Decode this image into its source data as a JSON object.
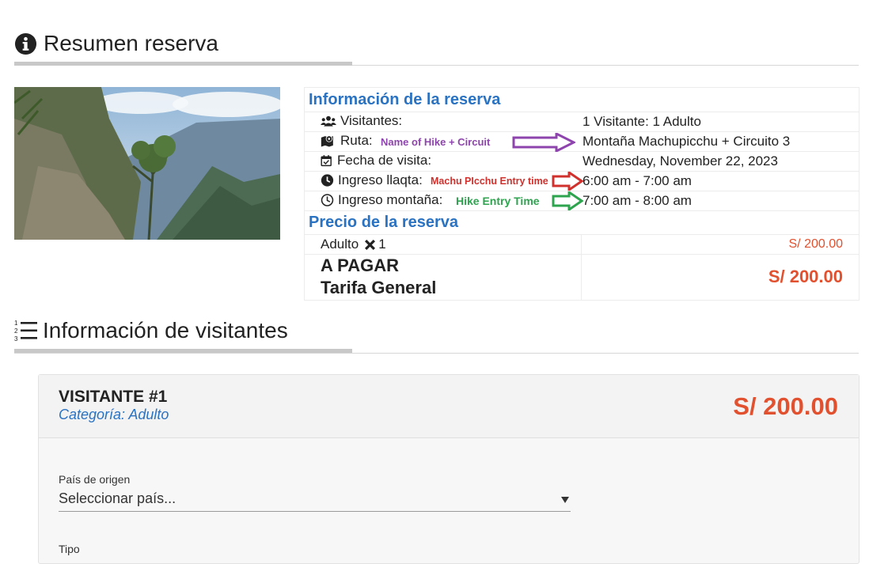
{
  "summary": {
    "title": "Resumen reserva",
    "icon": "info-circle-icon"
  },
  "reservation": {
    "info_header": "Información de la reserva",
    "rows": [
      {
        "icon": "users-icon",
        "label": "Visitantes:",
        "value": "1 Visitante: 1 Adulto"
      },
      {
        "icon": "map-marker-icon",
        "label": "Ruta:",
        "value": "Montaña Machupicchu + Circuito 3",
        "annotation": "Name of Hike + Circuit",
        "annotation_color": "#8e44ad"
      },
      {
        "icon": "calendar-check-icon",
        "label": "Fecha de visita:",
        "value": "Wednesday, November 22, 2023"
      },
      {
        "icon": "clock-solid-icon",
        "label": "Ingreso llaqta:",
        "value": "6:00 am - 7:00 am",
        "annotation": "Machu PIcchu Entry time",
        "annotation_color": "#d0312d"
      },
      {
        "icon": "clock-outline-icon",
        "label": "Ingreso montaña:",
        "value": "7:00 am - 8:00 am",
        "annotation": "Hike Entry Time",
        "annotation_color": "#2ea44f"
      }
    ],
    "price_header": "Precio de la reserva",
    "line_item": {
      "label": "Adulto",
      "multiplier": "1",
      "price": "S/ 200.00"
    },
    "total": {
      "label_line1": "A PAGAR",
      "label_line2": "Tarifa General",
      "price": "S/ 200.00"
    }
  },
  "visitors": {
    "title": "Información de visitantes",
    "icon": "numbered-list-icon",
    "cards": [
      {
        "title": "VISITANTE #1",
        "category": "Categoría: Adulto",
        "price": "S/ 200.00",
        "country_label": "País de origen",
        "country_placeholder": "Seleccionar país...",
        "type_label": "Tipo"
      }
    ]
  },
  "colors": {
    "accent_blue": "#2a72c2",
    "price_red": "#e1512f"
  }
}
